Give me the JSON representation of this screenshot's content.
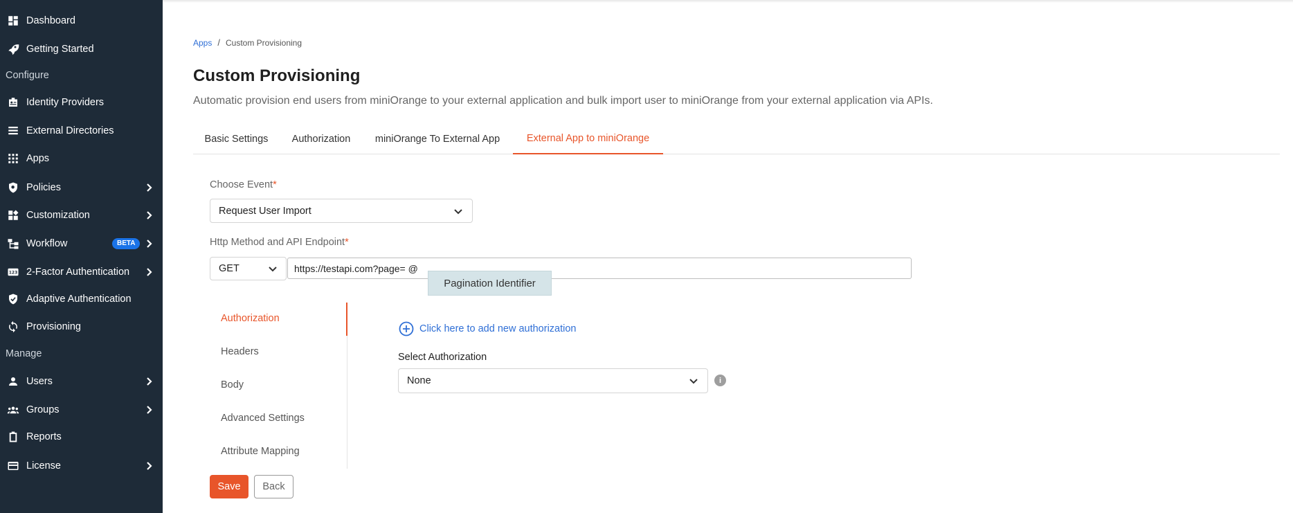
{
  "sidebar": {
    "items": [
      {
        "label": "Dashboard",
        "icon": "dashboard-icon"
      },
      {
        "label": "Getting Started",
        "icon": "rocket-icon"
      },
      {
        "label": "Identity Providers",
        "icon": "id-badge-icon"
      },
      {
        "label": "External Directories",
        "icon": "list-icon"
      },
      {
        "label": "Apps",
        "icon": "grid-icon"
      },
      {
        "label": "Policies",
        "icon": "shield-search-icon"
      },
      {
        "label": "Customization",
        "icon": "widgets-icon"
      },
      {
        "label": "Workflow",
        "icon": "workflow-icon",
        "badge": "BETA"
      },
      {
        "label": "2-Factor Authentication",
        "icon": "123-icon"
      },
      {
        "label": "Adaptive Authentication",
        "icon": "shield-check-icon"
      },
      {
        "label": "Provisioning",
        "icon": "sync-icon"
      },
      {
        "label": "Users",
        "icon": "user-icon"
      },
      {
        "label": "Groups",
        "icon": "groups-icon"
      },
      {
        "label": "Reports",
        "icon": "clipboard-icon"
      },
      {
        "label": "License",
        "icon": "card-icon"
      }
    ],
    "sections": {
      "configure": "Configure",
      "manage": "Manage"
    }
  },
  "breadcrumb": {
    "parent": "Apps",
    "separator": "/",
    "current": "Custom Provisioning"
  },
  "page": {
    "title": "Custom Provisioning",
    "description": "Automatic provision end users from miniOrange to your external application and bulk import user to miniOrange from your external application via APIs."
  },
  "tabs": [
    {
      "label": "Basic Settings"
    },
    {
      "label": "Authorization"
    },
    {
      "label": "miniOrange To External App"
    },
    {
      "label": "External App to miniOrange"
    }
  ],
  "active_tab": "External App to miniOrange",
  "form": {
    "choose_event_label": "Choose Event",
    "required_mark": "*",
    "choose_event_value": "Request User Import",
    "http_label": "Http Method and API Endpoint",
    "http_method": "GET",
    "endpoint_value": "https://testapi.com?page= @",
    "suggestion": "Pagination Identifier"
  },
  "subnav": [
    {
      "label": "Authorization"
    },
    {
      "label": "Headers"
    },
    {
      "label": "Body"
    },
    {
      "label": "Advanced Settings"
    },
    {
      "label": "Attribute Mapping"
    }
  ],
  "active_subnav": "Authorization",
  "auth_panel": {
    "add_link": "Click here to add new authorization",
    "select_label": "Select Authorization",
    "select_value": "None",
    "info_glyph": "i"
  },
  "actions": {
    "save": "Save",
    "back": "Back"
  },
  "colors": {
    "sidebar_bg": "#1e2b38",
    "accent": "#e8552a",
    "link": "#2f6fd6",
    "badge": "#1a73e8"
  }
}
